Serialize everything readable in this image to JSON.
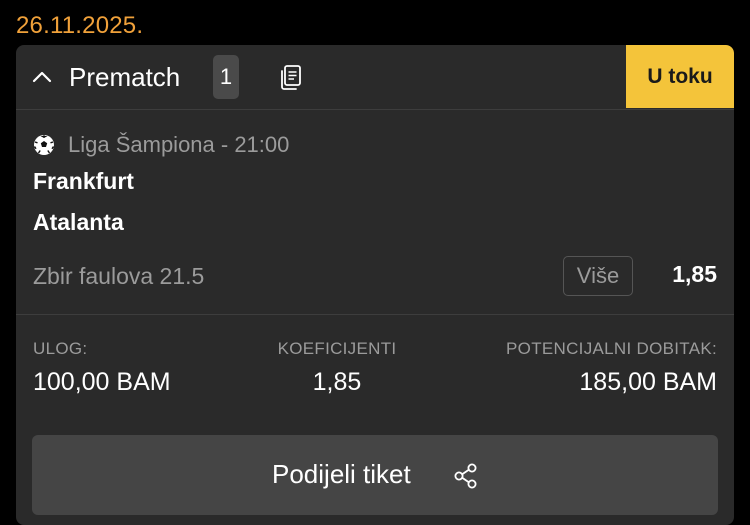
{
  "date": "26.11.2025.",
  "ticket": {
    "header": {
      "title": "Prematch",
      "count": "1",
      "status": "U toku"
    },
    "match": {
      "league": "Liga Šampiona - 21:00",
      "home_team": "Frankfurt",
      "away_team": "Atalanta",
      "market": "Zbir faulova 21.5",
      "pick": "Više",
      "odds": "1,85"
    },
    "summary": {
      "stake_label": "ULOG:",
      "stake_value": "100,00 BAM",
      "odds_label": "KOEFICIJENTI",
      "odds_value": "1,85",
      "win_label": "POTENCIJALNI DOBITAK:",
      "win_value": "185,00 BAM"
    },
    "share_label": "Podijeli tiket"
  },
  "colors": {
    "accent_date": "#f0a13a",
    "status_bg": "#f4c43a",
    "card_bg": "#2a2a2a"
  },
  "icons": [
    "chevron-up-icon",
    "document-copy-icon",
    "soccer-ball-icon",
    "share-icon"
  ]
}
